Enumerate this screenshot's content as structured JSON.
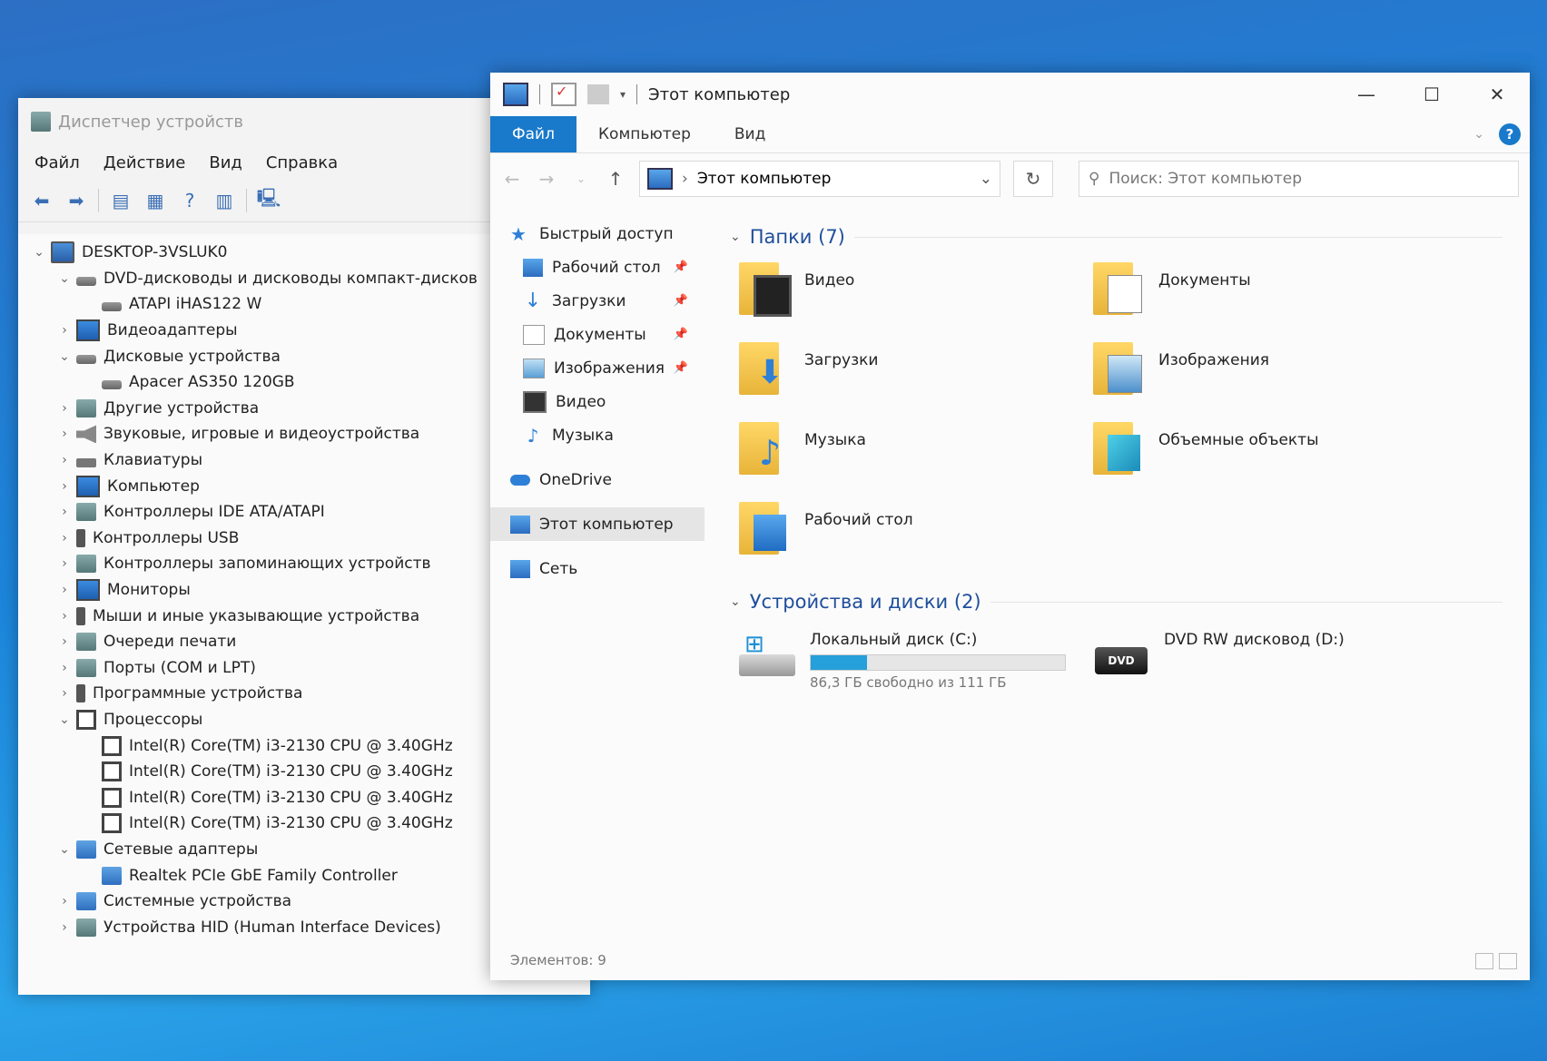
{
  "device_manager": {
    "title": "Диспетчер устройств",
    "menu": [
      "Файл",
      "Действие",
      "Вид",
      "Справка"
    ],
    "tree": [
      {
        "label": "DESKTOP-3VSLUK0",
        "depth": 0,
        "state": "expanded",
        "icon": "computer-icon"
      },
      {
        "label": "DVD-дисководы и дисководы компакт-дисков",
        "depth": 1,
        "state": "expanded",
        "icon": "dvd-drive-icon"
      },
      {
        "label": "ATAPI iHAS122   W",
        "depth": 2,
        "state": "leaf",
        "icon": "dvd-drive-icon"
      },
      {
        "label": "Видеоадаптеры",
        "depth": 1,
        "state": "collapsed",
        "icon": "display-adapter-icon"
      },
      {
        "label": "Дисковые устройства",
        "depth": 1,
        "state": "expanded",
        "icon": "disk-drive-icon"
      },
      {
        "label": "Apacer AS350 120GB",
        "depth": 2,
        "state": "leaf",
        "icon": "disk-drive-icon"
      },
      {
        "label": "Другие устройства",
        "depth": 1,
        "state": "collapsed",
        "icon": "other-devices-icon"
      },
      {
        "label": "Звуковые, игровые и видеоустройства",
        "depth": 1,
        "state": "collapsed",
        "icon": "speaker-icon"
      },
      {
        "label": "Клавиатуры",
        "depth": 1,
        "state": "collapsed",
        "icon": "keyboard-icon"
      },
      {
        "label": "Компьютер",
        "depth": 1,
        "state": "collapsed",
        "icon": "monitor-icon"
      },
      {
        "label": "Контроллеры IDE ATA/ATAPI",
        "depth": 1,
        "state": "collapsed",
        "icon": "ide-controller-icon"
      },
      {
        "label": "Контроллеры USB",
        "depth": 1,
        "state": "collapsed",
        "icon": "usb-icon"
      },
      {
        "label": "Контроллеры запоминающих устройств",
        "depth": 1,
        "state": "collapsed",
        "icon": "storage-controller-icon"
      },
      {
        "label": "Мониторы",
        "depth": 1,
        "state": "collapsed",
        "icon": "monitor-icon"
      },
      {
        "label": "Мыши и иные указывающие устройства",
        "depth": 1,
        "state": "collapsed",
        "icon": "mouse-icon"
      },
      {
        "label": "Очереди печати",
        "depth": 1,
        "state": "collapsed",
        "icon": "printer-icon"
      },
      {
        "label": "Порты (COM и LPT)",
        "depth": 1,
        "state": "collapsed",
        "icon": "port-icon"
      },
      {
        "label": "Программные устройства",
        "depth": 1,
        "state": "collapsed",
        "icon": "software-device-icon"
      },
      {
        "label": "Процессоры",
        "depth": 1,
        "state": "expanded",
        "icon": "processor-icon"
      },
      {
        "label": "Intel(R) Core(TM) i3-2130 CPU @ 3.40GHz",
        "depth": 2,
        "state": "leaf",
        "icon": "processor-icon"
      },
      {
        "label": "Intel(R) Core(TM) i3-2130 CPU @ 3.40GHz",
        "depth": 2,
        "state": "leaf",
        "icon": "processor-icon"
      },
      {
        "label": "Intel(R) Core(TM) i3-2130 CPU @ 3.40GHz",
        "depth": 2,
        "state": "leaf",
        "icon": "processor-icon"
      },
      {
        "label": "Intel(R) Core(TM) i3-2130 CPU @ 3.40GHz",
        "depth": 2,
        "state": "leaf",
        "icon": "processor-icon"
      },
      {
        "label": "Сетевые адаптеры",
        "depth": 1,
        "state": "expanded",
        "icon": "network-adapter-icon"
      },
      {
        "label": "Realtek PCIe GbE Family Controller",
        "depth": 2,
        "state": "leaf",
        "icon": "network-adapter-icon"
      },
      {
        "label": "Системные устройства",
        "depth": 1,
        "state": "collapsed",
        "icon": "system-devices-icon"
      },
      {
        "label": "Устройства HID (Human Interface Devices)",
        "depth": 1,
        "state": "collapsed",
        "icon": "hid-icon"
      }
    ]
  },
  "explorer": {
    "title": "Этот компьютер",
    "ribbon_tabs": [
      "Файл",
      "Компьютер",
      "Вид"
    ],
    "address": "Этот компьютер",
    "search_placeholder": "Поиск: Этот компьютер",
    "nav": [
      {
        "label": "Быстрый доступ",
        "icon": "star-icon",
        "pinned": false
      },
      {
        "label": "Рабочий стол",
        "icon": "desktop-icon",
        "pinned": true
      },
      {
        "label": "Загрузки",
        "icon": "download-icon",
        "pinned": true
      },
      {
        "label": "Документы",
        "icon": "documents-icon",
        "pinned": true
      },
      {
        "label": "Изображения",
        "icon": "pictures-icon",
        "pinned": true
      },
      {
        "label": "Видео",
        "icon": "video-icon",
        "pinned": false
      },
      {
        "label": "Музыка",
        "icon": "music-icon",
        "pinned": false
      },
      {
        "label": "OneDrive",
        "icon": "cloud-icon",
        "pinned": false
      },
      {
        "label": "Этот компьютер",
        "icon": "this-pc-icon",
        "pinned": false,
        "selected": true
      },
      {
        "label": "Сеть",
        "icon": "network-icon",
        "pinned": false
      }
    ],
    "folders_header": "Папки (7)",
    "folders": [
      {
        "label": "Видео",
        "icon": "video-folder-icon"
      },
      {
        "label": "Документы",
        "icon": "documents-folder-icon"
      },
      {
        "label": "Загрузки",
        "icon": "downloads-folder-icon"
      },
      {
        "label": "Изображения",
        "icon": "pictures-folder-icon"
      },
      {
        "label": "Музыка",
        "icon": "music-folder-icon"
      },
      {
        "label": "Объемные объекты",
        "icon": "3d-objects-folder-icon"
      },
      {
        "label": "Рабочий стол",
        "icon": "desktop-folder-icon"
      }
    ],
    "drives_header": "Устройства и диски (2)",
    "drives": [
      {
        "label": "Локальный диск (C:)",
        "free_text": "86,3 ГБ свободно из 111 ГБ",
        "used_fraction": 0.22,
        "icon": "local-disk-icon"
      },
      {
        "label": "DVD RW дисковод (D:)",
        "icon": "dvd-drive-icon",
        "badge": "DVD"
      }
    ],
    "status": "Элементов: 9",
    "accent": "#1979ca",
    "bar_color": "#26a0da"
  }
}
